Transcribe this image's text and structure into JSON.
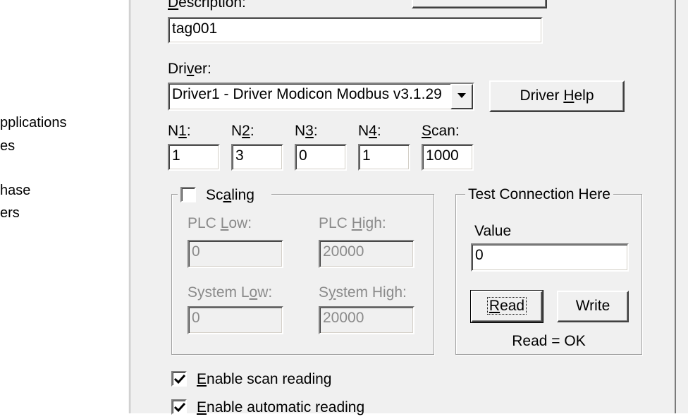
{
  "left_panel": {
    "items": [
      "pplications",
      "es",
      "hase",
      "ers"
    ]
  },
  "form": {
    "description_label_prefix": "",
    "description_label_mnemonic": "D",
    "description_label_rest": "escription:",
    "description_value": "tag001",
    "driver_label_pre": "Dri",
    "driver_label_mnemonic": "v",
    "driver_label_post": "er:",
    "driver_selected": "Driver1 - Driver Modicon Modbus v3.1.29",
    "driver_help_pre": "Driver ",
    "driver_help_mnemonic": "H",
    "driver_help_post": "elp",
    "n_fields": [
      {
        "label_pre": "N",
        "label_mnemonic": "1",
        "label_post": ":",
        "value": "1"
      },
      {
        "label_pre": "N",
        "label_mnemonic": "2",
        "label_post": ":",
        "value": "3"
      },
      {
        "label_pre": "N",
        "label_mnemonic": "3",
        "label_post": ":",
        "value": "0"
      },
      {
        "label_pre": "N",
        "label_mnemonic": "4",
        "label_post": ":",
        "value": "1"
      }
    ],
    "scan_label_mnemonic": "S",
    "scan_label_post": "can:",
    "scan_value": "1000"
  },
  "scaling": {
    "label_pre": "Sc",
    "label_mnemonic": "a",
    "label_post": "ling",
    "checked": false,
    "plc_low_pre": "PLC ",
    "plc_low_mnemonic": "L",
    "plc_low_post": "ow:",
    "plc_low_value": "0",
    "plc_high_pre": "PLC ",
    "plc_high_mnemonic": "H",
    "plc_high_post": "igh:",
    "plc_high_value": "20000",
    "sys_low_pre": "System L",
    "sys_low_mnemonic": "o",
    "sys_low_post": "w:",
    "sys_low_value": "0",
    "sys_high_pre": "S",
    "sys_high_mnemonic": "y",
    "sys_high_post": "stem High:",
    "sys_high_value": "20000"
  },
  "test": {
    "title": "Test Connection Here",
    "value_label": "Value",
    "value": "0",
    "read_pre": "",
    "read_mnemonic": "R",
    "read_post": "ead",
    "write_label": "Write",
    "status": "Read = OK"
  },
  "options": {
    "scan_pre": "",
    "scan_mnemonic": "E",
    "scan_post": "nable scan reading",
    "scan_checked": true,
    "auto_pre": "",
    "auto_mnemonic": "E",
    "auto_post": "nable automatic reading",
    "auto_checked": true
  }
}
